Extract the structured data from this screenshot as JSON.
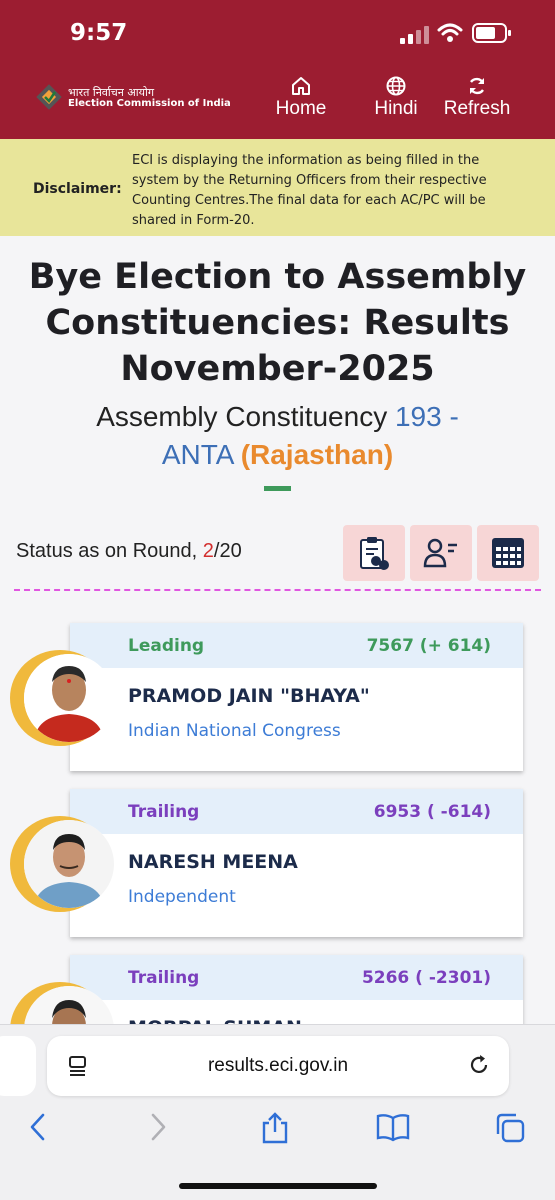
{
  "status_bar": {
    "time": "9:57"
  },
  "header": {
    "brand_hindi": "भारत निर्वाचन आयोग",
    "brand_english": "Election Commission of India",
    "nav": {
      "home": "Home",
      "hindi": "Hindi",
      "refresh": "Refresh"
    },
    "background": "#9c1d31"
  },
  "disclaimer": {
    "label": "Disclaimer:",
    "text": "ECI is displaying the information as being filled in the system by the Returning Officers from their respective Counting Centres.The final data for each AC/PC will be shared in Form-20."
  },
  "page": {
    "title": "Bye Election to Assembly Constituencies: Results November-2025",
    "subtitle_prefix": "Assembly Constituency",
    "constituency_number": "193 -",
    "constituency_name": "ANTA",
    "state": "(Rajasthan)"
  },
  "round": {
    "label": "Status as on Round,",
    "current": "2",
    "total": "/20"
  },
  "candidates": [
    {
      "status": "Leading",
      "votes": "7567 (+ 614)",
      "name": "PRAMOD JAIN \"BHAYA\"",
      "party": "Indian National Congress"
    },
    {
      "status": "Trailing",
      "votes": "6953 ( -614)",
      "name": "NARESH MEENA",
      "party": "Independent"
    },
    {
      "status": "Trailing",
      "votes": "5266 ( -2301)",
      "name": "MORPAL SUMAN",
      "party": ""
    }
  ],
  "browser": {
    "url": "results.eci.gov.in"
  },
  "icons": {
    "home": "home-icon",
    "hindi": "globe-icon",
    "refresh": "refresh-icon",
    "tool1": "clipboard-icon",
    "tool2": "user-list-icon",
    "tool3": "calendar-grid-icon"
  },
  "colors": {
    "leading": "#3e9a5b",
    "trailing": "#7b3fbd",
    "state": "#e98a2e",
    "number": "#3d6fb6",
    "dash": "#e056e0"
  }
}
